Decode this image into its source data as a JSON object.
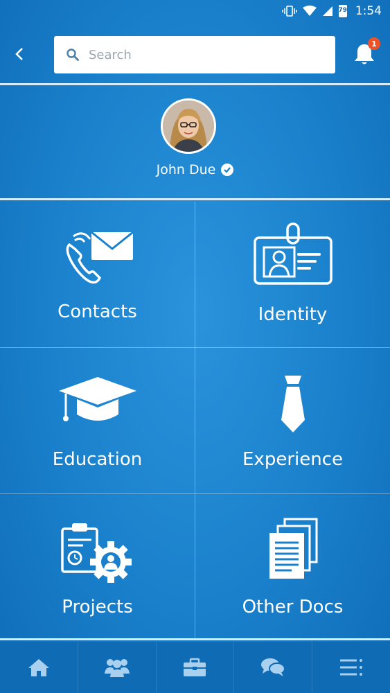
{
  "status_bar": {
    "time": "1:54",
    "battery_level": "79"
  },
  "header": {
    "search_placeholder": "Search",
    "notification_count": "1"
  },
  "profile": {
    "name": "John Due",
    "verified": true
  },
  "tiles": [
    {
      "label": "Contacts",
      "icon": "phone-mail-icon"
    },
    {
      "label": "Identity",
      "icon": "id-badge-icon"
    },
    {
      "label": "Education",
      "icon": "graduation-cap-icon"
    },
    {
      "label": "Experience",
      "icon": "tie-icon"
    },
    {
      "label": "Projects",
      "icon": "clipboard-gear-icon"
    },
    {
      "label": "Other Docs",
      "icon": "documents-icon"
    }
  ],
  "bottom_nav": [
    {
      "icon": "home-icon"
    },
    {
      "icon": "users-icon"
    },
    {
      "icon": "briefcase-icon"
    },
    {
      "icon": "chat-icon"
    },
    {
      "icon": "menu-icon"
    }
  ],
  "colors": {
    "background": "#1a80cb",
    "accent_badge": "#f05228",
    "nav_background": "#0e6bb4"
  }
}
